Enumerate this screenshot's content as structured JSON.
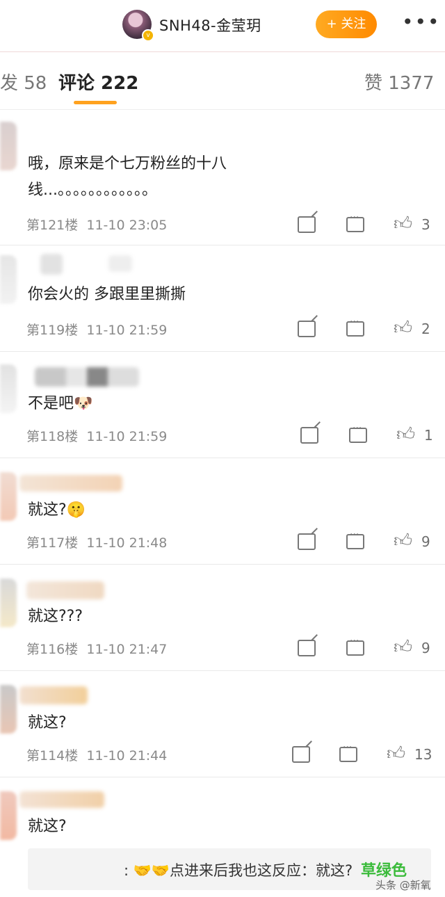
{
  "header": {
    "account_name": "SNH48-金莹玥",
    "follow_label": "+ 关注",
    "more_label": "•••"
  },
  "tabs": {
    "repost": "发 58",
    "comment": "评论 222",
    "like": "赞 1377"
  },
  "comments": [
    {
      "text": "哦，原来是个七万粉丝的十八\n线...。。。。。。。。。。。。",
      "floor": "第121楼",
      "time": "11-10 23:05",
      "likes": "3"
    },
    {
      "text": "你会火的 多跟里里撕撕",
      "floor": "第119楼",
      "time": "11-10 21:59",
      "likes": "2"
    },
    {
      "text": "不是吧🐶",
      "floor": "第118楼",
      "time": "11-10 21:59",
      "likes": "1"
    },
    {
      "text": "就这?🤫",
      "floor": "第117楼",
      "time": "11-10 21:48",
      "likes": "9"
    },
    {
      "text": "就这???",
      "floor": "第116楼",
      "time": "11-10 21:47",
      "likes": "9"
    },
    {
      "text": "就这?",
      "floor": "第114楼",
      "time": "11-10 21:44",
      "likes": "13"
    },
    {
      "text": "就这?"
    }
  ],
  "banner": {
    "text": ": 🤝🤝点进来后我也这反应：就这?"
  },
  "watermarks": {
    "green": "草绿色",
    "gray": "头条 @新氧"
  },
  "colors": {
    "accent": "#ffa21f",
    "follow_button": "#ff9a10"
  }
}
